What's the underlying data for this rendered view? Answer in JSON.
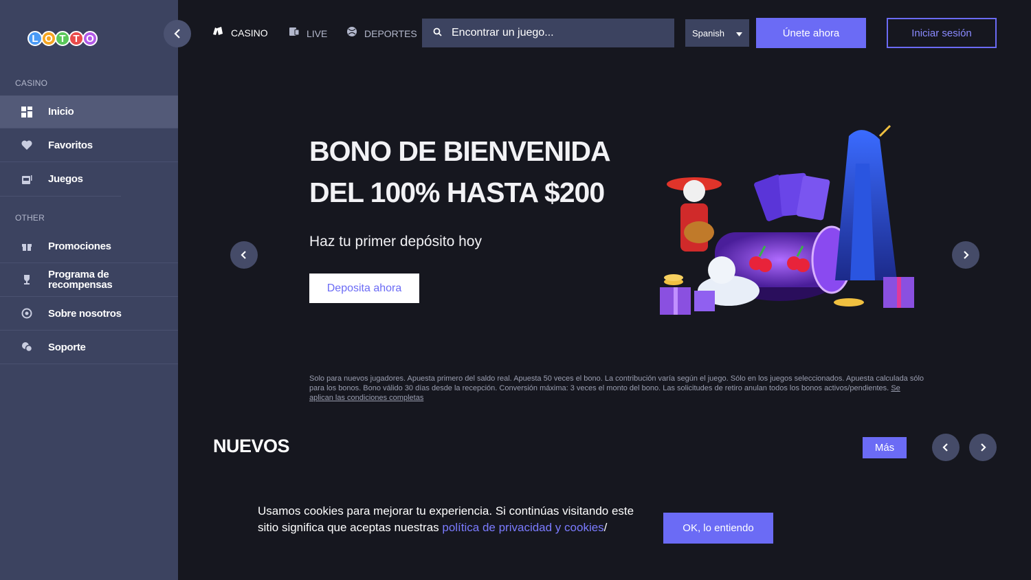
{
  "logo": {
    "letters": [
      "L",
      "O",
      "T",
      "T",
      "O"
    ],
    "colors": [
      "#4a9af5",
      "#f5a623",
      "#5ac85a",
      "#e84b4b",
      "#b25ae8"
    ]
  },
  "sidebar": {
    "section_casino": "CASINO",
    "section_other": "OTHER",
    "items": [
      {
        "label": "Inicio",
        "icon": "grid-icon"
      },
      {
        "label": "Favoritos",
        "icon": "heart-icon"
      },
      {
        "label": "Juegos",
        "icon": "slot-machine-icon"
      },
      {
        "label": "Promociones",
        "icon": "gift-icon"
      },
      {
        "label": "Programa de recompensas",
        "icon": "trophy-icon"
      },
      {
        "label": "Sobre nosotros",
        "icon": "info-circle-icon"
      },
      {
        "label": "Soporte",
        "icon": "chat-icon"
      }
    ]
  },
  "topnav": {
    "casino": "CASINO",
    "live": "LIVE",
    "deportes": "DEPORTES",
    "search_placeholder": "Encontrar un juego...",
    "language": "Spanish",
    "join": "Únete ahora",
    "login": "Iniciar sesión"
  },
  "hero": {
    "title_line1": "BONO DE BIENVENIDA",
    "title_line2": "DEL 100% HASTA $200",
    "subtitle": "Haz tu primer depósito hoy",
    "cta": "Deposita ahora",
    "terms": "Solo para nuevos jugadores. Apuesta primero del saldo real. Apuesta 50 veces el bono. La contribución varía según el juego. Sólo en los juegos seleccionados. Apuesta calculada sólo para los bonos. Bono válido 30 días desde la recepción. Conversión máxima: 3 veces el monto del bono. Las solicitudes de retiro anulan todos los bonos activos/pendientes.",
    "terms_link": "Se aplican las condiciones completas"
  },
  "nuevos": {
    "title": "NUEVOS",
    "more": "Más"
  },
  "cookie": {
    "text": "Usamos cookies para mejorar tu experiencia. Si continúas visitando este sitio significa que aceptas nuestras ",
    "link": "política de privacidad y cookies",
    "suffix": "/",
    "ok": "OK, lo entiendo"
  },
  "colors": {
    "accent": "#6b6bf5",
    "sidebar": "#3c4360",
    "background": "#16171f"
  }
}
